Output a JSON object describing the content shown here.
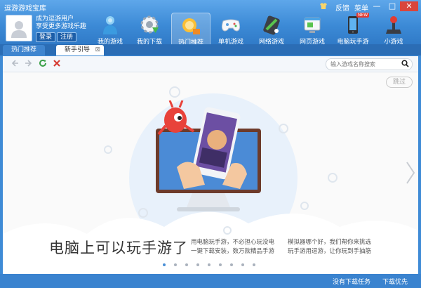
{
  "app": {
    "title": "逗游游戏宝库"
  },
  "window_controls": {
    "feedback": "反馈",
    "menu": "菜单",
    "minimize": "—",
    "maximize": "□",
    "close": "✕"
  },
  "user": {
    "line1": "成为逗游用户",
    "line2": "享受更多游戏乐趣",
    "login": "登录",
    "register": "注册"
  },
  "nav": {
    "items": [
      {
        "label": "我的游戏",
        "icon": "person-icon"
      },
      {
        "label": "我的下载",
        "icon": "download-gear-icon"
      },
      {
        "label": "热门推荐",
        "icon": "hot-recommend-icon"
      },
      {
        "label": "单机游戏",
        "icon": "gamepad-icon"
      },
      {
        "label": "网络游戏",
        "icon": "online-game-icon"
      },
      {
        "label": "网页游戏",
        "icon": "web-game-icon"
      },
      {
        "label": "电脑玩手游",
        "icon": "phone-icon"
      },
      {
        "label": "小游戏",
        "icon": "joystick-icon"
      }
    ],
    "phone_badge": "NEW"
  },
  "tabs": [
    {
      "label": "热门推荐"
    },
    {
      "label": "新手引导",
      "close": "⊠"
    }
  ],
  "toolbar": {
    "search_placeholder": "输入游戏名称搜索"
  },
  "guide": {
    "skip": "跳过",
    "headline": "电脑上可以玩手游了",
    "desc_col1": [
      "用电脑玩手游，不必担心玩没电",
      "一键下载安装，数万款精品手游"
    ],
    "desc_col2": [
      "模拟器哪个好，我们帮你来挑选",
      "玩手游用逗游，让你玩到手抽筋"
    ],
    "page_count": 9,
    "current_page": 1
  },
  "status": {
    "no_tasks": "没有下载任务",
    "priority": "下载优先"
  }
}
